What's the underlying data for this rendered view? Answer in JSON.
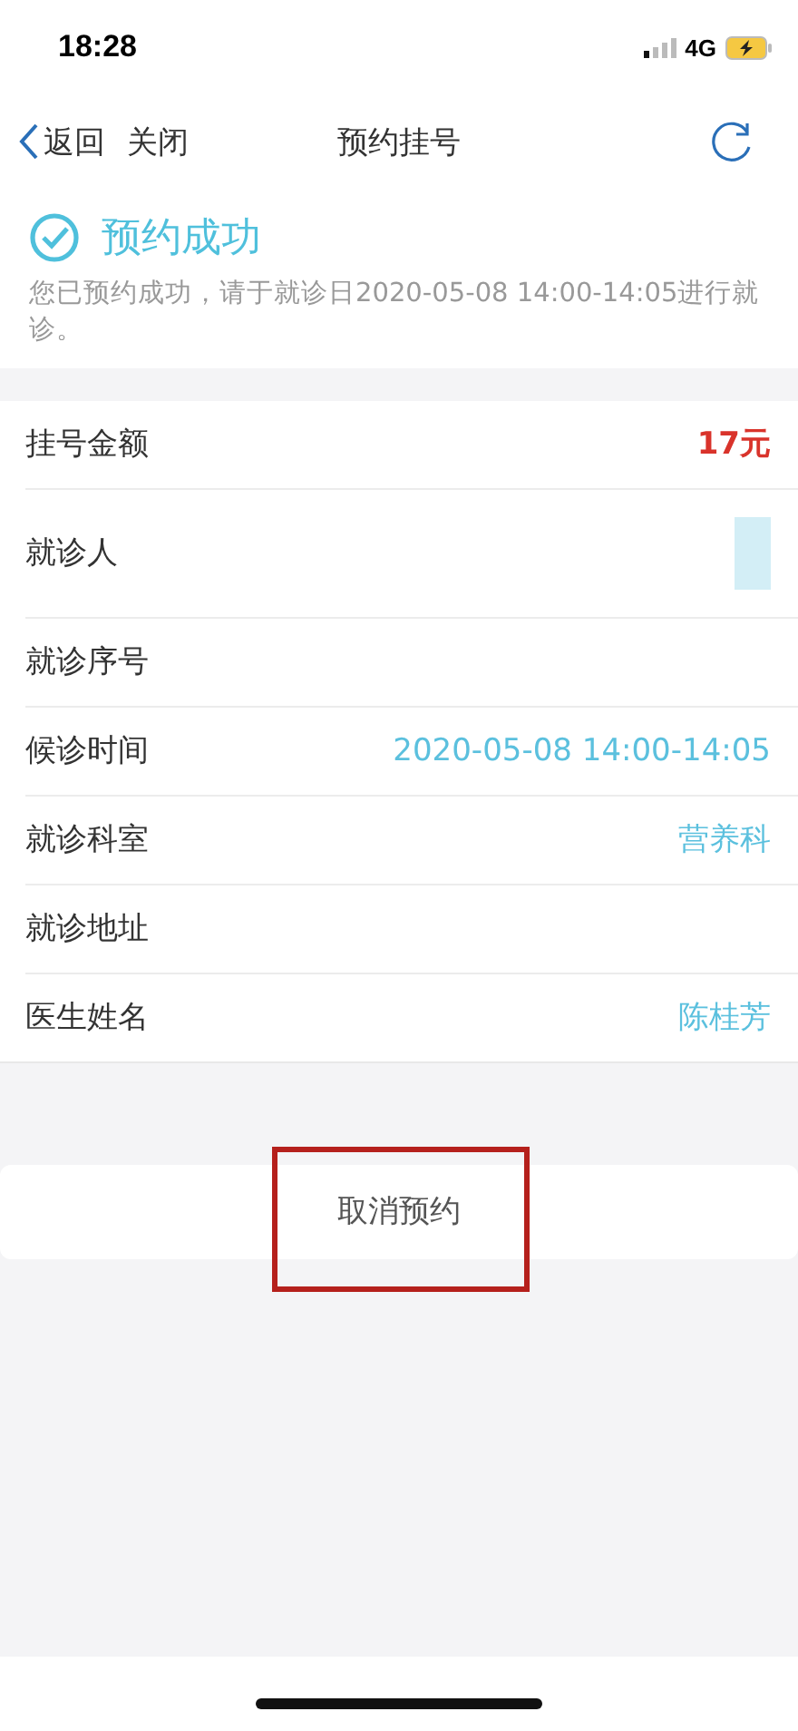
{
  "status_bar": {
    "time": "18:28",
    "network": "4G"
  },
  "nav": {
    "back": "返回",
    "close": "关闭",
    "title": "预约挂号"
  },
  "result": {
    "title": "预约成功",
    "message": "您已预约成功，请于就诊日2020-05-08 14:00-14:05进行就诊。"
  },
  "details": [
    {
      "label": "挂号金额",
      "value": "17元",
      "kind": "price"
    },
    {
      "label": "就诊人",
      "kind": "redacted"
    },
    {
      "label": "就诊序号",
      "kind": "empty"
    },
    {
      "label": "候诊时间",
      "value": "2020-05-08 14:00-14:05",
      "kind": "info"
    },
    {
      "label": "就诊科室",
      "value": "营养科",
      "kind": "info"
    },
    {
      "label": "就诊地址",
      "kind": "empty"
    },
    {
      "label": "医生姓名",
      "value": "陈桂芳",
      "kind": "info"
    }
  ],
  "cancel_button": {
    "label": "取消预约",
    "highlighted": true
  }
}
